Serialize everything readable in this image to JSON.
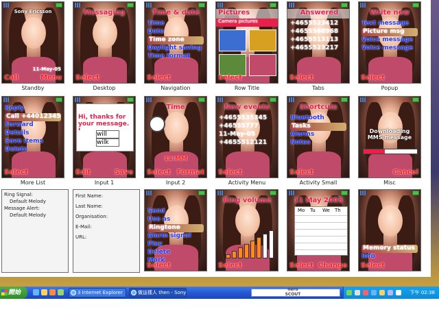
{
  "themes": [
    {
      "id": "standby",
      "caption": "Standby",
      "title": "Sony Ericsson",
      "soft_left": "Call",
      "soft_right": "Menu",
      "date": "11-May-05"
    },
    {
      "id": "desktop",
      "caption": "Desktop",
      "title": "Messaging",
      "soft_left": "Select",
      "soft_right": ""
    },
    {
      "id": "navigation",
      "caption": "Navigation",
      "title": "Time & date",
      "items": [
        "Time",
        "Date",
        "Time zone",
        "Daylight saving",
        "Time format"
      ],
      "soft_left": "Select",
      "soft_right": ""
    },
    {
      "id": "row-title",
      "caption": "Row Title",
      "title": "Pictures",
      "subtitle": "Camera pictures",
      "soft_left": "Select",
      "soft_right": ""
    },
    {
      "id": "tabs",
      "caption": "Tabs",
      "title": "Answered",
      "items": [
        "+4655523412",
        "+4655568968",
        "+4655513113",
        "+4655523217"
      ],
      "soft_left": "Select",
      "soft_right": ""
    },
    {
      "id": "popup",
      "caption": "Popup",
      "title": "Write new",
      "items": [
        "Text message",
        "Picture msg",
        "Voice message",
        "Voice message"
      ],
      "soft_left": "Select",
      "soft_right": ""
    },
    {
      "id": "more-list",
      "caption": "More List",
      "items": [
        "Reply",
        "Call +440123456",
        "Forward",
        "Details",
        "Save items",
        "Delete"
      ],
      "soft_left": "Select",
      "soft_right": ""
    },
    {
      "id": "input-1",
      "caption": "Input 1",
      "text": "Hi, thanks for your message. I",
      "suggestions": [
        "will",
        "wilk"
      ],
      "soft_left": "Edit",
      "soft_right": "Save"
    },
    {
      "id": "input-2",
      "caption": "Input 2",
      "title": "Time",
      "value": "14:MM",
      "soft_left": "Select",
      "soft_right": "Format"
    },
    {
      "id": "activity-menu",
      "caption": "Activity Menu",
      "title": "New events",
      "items": [
        "+4655535345",
        "+46555777",
        "11-May-05",
        "+4655512121"
      ],
      "soft_left": "Select",
      "soft_right": ""
    },
    {
      "id": "activity-small",
      "caption": "Activity Small",
      "title": "Shortcuts",
      "items": [
        "Bluetooth",
        "Tasks",
        "Alarms",
        "Notes"
      ],
      "soft_left": "Select",
      "soft_right": ""
    },
    {
      "id": "misc",
      "caption": "Misc",
      "title": "Downloading MMS message",
      "soft_left": "",
      "soft_right": "Cancel"
    },
    {
      "id": "menu-send",
      "caption": "",
      "items": [
        "Send",
        "Use as",
        "Ringtone",
        "Alarm signal",
        "Play",
        "Delete",
        "Mark"
      ],
      "soft_left": "Select",
      "soft_right": ""
    },
    {
      "id": "ring-volume",
      "caption": "",
      "title": "Ring volume",
      "level": 0.8,
      "soft_left": "Select",
      "soft_right": ""
    },
    {
      "id": "calendar",
      "caption": "",
      "title": "11 May 2005",
      "days": [
        "Mo",
        "Tu",
        "We",
        "Th"
      ],
      "soft_left": "Select",
      "soft_right": "Change"
    },
    {
      "id": "memory-status",
      "caption": "",
      "items": [
        "Memory status",
        "Info"
      ],
      "soft_left": "Select",
      "soft_right": ""
    }
  ],
  "panels": {
    "ring_info": [
      "Ring Signal:",
      "Default Melody",
      "Message Alert:",
      "Default Melody"
    ],
    "contact_info": [
      "First Name:",
      "Last Name:",
      "Organisation:",
      "E-Mail:",
      "URL:"
    ]
  },
  "taskbar": {
    "start_label": "開始",
    "tasks": [
      "3 Internet Explorer",
      "做這樣人 then - Sony ..."
    ],
    "search_placeholder": "",
    "nero_label": "nero SCOUT",
    "clock": "下午 02:38"
  }
}
